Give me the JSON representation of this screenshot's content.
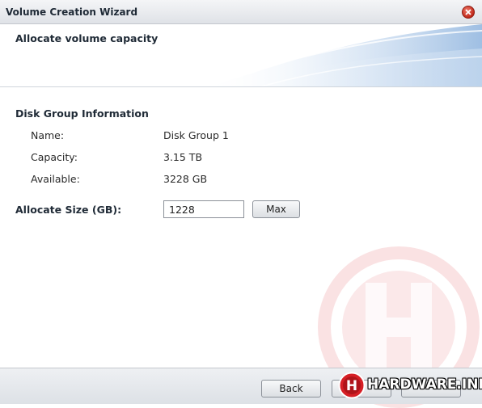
{
  "window": {
    "title": "Volume Creation Wizard",
    "close_icon": "close-icon"
  },
  "header": {
    "title": "Allocate volume capacity"
  },
  "disk_group": {
    "section_title": "Disk Group Information",
    "rows": [
      {
        "label": "Name:",
        "value": "Disk Group 1"
      },
      {
        "label": "Capacity:",
        "value": "3.15 TB"
      },
      {
        "label": "Available:",
        "value": "3228 GB"
      }
    ]
  },
  "allocate": {
    "label": "Allocate Size (GB):",
    "value": "1228",
    "max_label": "Max"
  },
  "footer": {
    "back_label": "Back",
    "next_label": "",
    "cancel_label": ""
  },
  "watermark": {
    "logo_text": "HARDWARE.INFO",
    "badge_letter": "H"
  },
  "colors": {
    "close": "#c0281a",
    "header_accent": "#b7cde8",
    "watermark": "#d61f26"
  }
}
